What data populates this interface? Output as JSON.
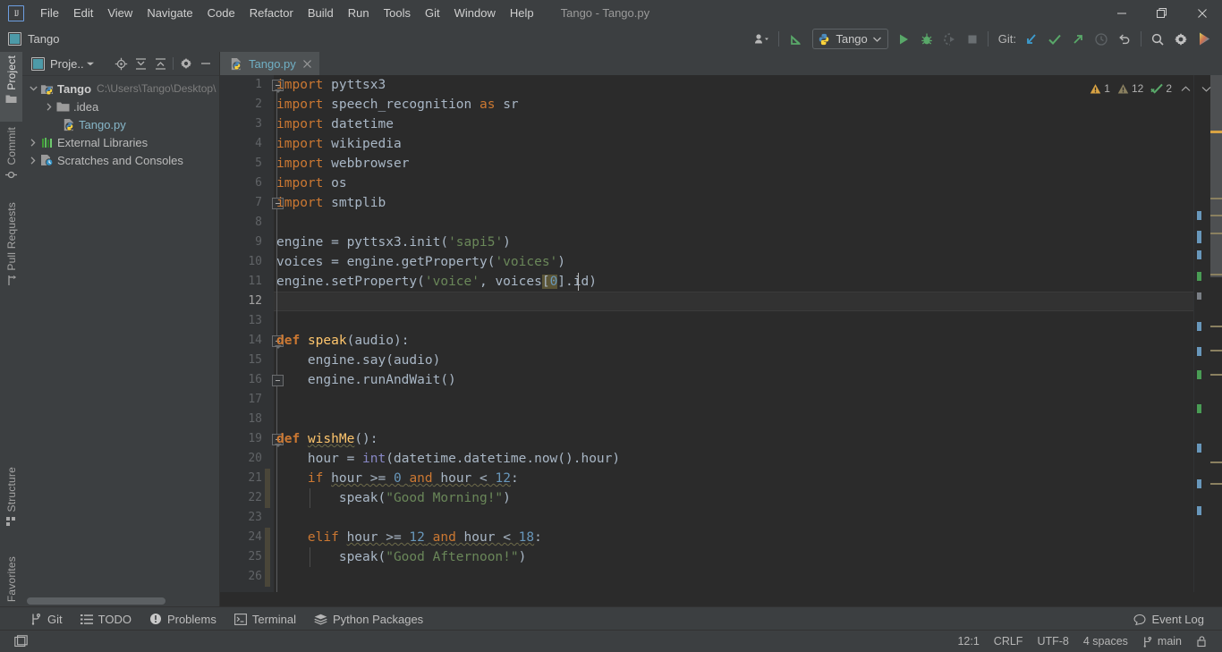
{
  "window": {
    "title": "Tango - Tango.py",
    "logo_text": "IJ",
    "controls": {
      "minimize": "minimize-icon",
      "maximize": "maximize-icon",
      "close": "close-icon"
    }
  },
  "menubar": {
    "items": [
      {
        "label": "File"
      },
      {
        "label": "Edit"
      },
      {
        "label": "View"
      },
      {
        "label": "Navigate"
      },
      {
        "label": "Code"
      },
      {
        "label": "Refactor"
      },
      {
        "label": "Build"
      },
      {
        "label": "Run"
      },
      {
        "label": "Tools"
      },
      {
        "label": "Git"
      },
      {
        "label": "Window"
      },
      {
        "label": "Help"
      }
    ]
  },
  "toolbar": {
    "project_name": "Tango",
    "run_config": "Tango",
    "git_label": "Git:",
    "icons": [
      "user-switch-icon",
      "update-project-icon",
      "python-icon",
      "chevron-down-icon",
      "run-icon",
      "debug-icon",
      "run-coverage-icon",
      "stop-icon",
      "git-update-icon",
      "git-commit-icon",
      "git-push-icon",
      "history-icon",
      "undo-icon",
      "search-everywhere-icon",
      "settings-icon",
      "ide-help-icon"
    ]
  },
  "left_strip": {
    "tabs": [
      {
        "label": "Project",
        "icon": "project-folder-icon",
        "active": true
      },
      {
        "label": "Commit",
        "icon": "commit-icon",
        "active": false
      },
      {
        "label": "Pull Requests",
        "icon": "pull-request-icon",
        "active": false
      },
      {
        "label": "Structure",
        "icon": "structure-icon",
        "active": false
      },
      {
        "label": "Favorites",
        "icon": "star-icon",
        "active": false
      }
    ]
  },
  "project_panel": {
    "title": "Proje..",
    "toolbar_icons": [
      "select-opened-file-icon",
      "expand-all-icon",
      "collapse-all-icon",
      "settings-icon",
      "hide-icon"
    ],
    "tree": [
      {
        "label": "Tango",
        "path": "C:\\Users\\Tango\\Desktop\\",
        "icon": "python-project-icon",
        "indent": 0,
        "arrow": "expanded",
        "bold": true
      },
      {
        "label": ".idea",
        "path": "",
        "icon": "folder-icon",
        "indent": 1,
        "arrow": "collapsed",
        "bold": false
      },
      {
        "label": "Tango.py",
        "path": "",
        "icon": "python-file-icon",
        "indent": 1,
        "arrow": "none",
        "bold": false,
        "link": true
      },
      {
        "label": "External Libraries",
        "path": "",
        "icon": "libraries-icon",
        "indent": 0,
        "arrow": "collapsed",
        "bold": false
      },
      {
        "label": "Scratches and Consoles",
        "path": "",
        "icon": "scratches-icon",
        "indent": 0,
        "arrow": "collapsed",
        "bold": false
      }
    ]
  },
  "editor": {
    "tab": {
      "label": "Tango.py",
      "icon": "python-file-icon",
      "close": "close-icon"
    },
    "inspections": {
      "warnings_count": "1",
      "weak_warnings_count": "12",
      "ok_count": "2",
      "up_icon": "chevron-up-icon",
      "down_icon": "chevron-down-icon"
    },
    "current_line": 12,
    "lines": [
      {
        "n": 1,
        "text": "import pyttsx3"
      },
      {
        "n": 2,
        "text": "import speech_recognition as sr"
      },
      {
        "n": 3,
        "text": "import datetime"
      },
      {
        "n": 4,
        "text": "import wikipedia"
      },
      {
        "n": 5,
        "text": "import webbrowser"
      },
      {
        "n": 6,
        "text": "import os"
      },
      {
        "n": 7,
        "text": "import smtplib"
      },
      {
        "n": 8,
        "text": ""
      },
      {
        "n": 9,
        "text": "engine = pyttsx3.init('sapi5')"
      },
      {
        "n": 10,
        "text": "voices = engine.getProperty('voices')"
      },
      {
        "n": 11,
        "text": "engine.setProperty('voice', voices[0].id)"
      },
      {
        "n": 12,
        "text": ""
      },
      {
        "n": 13,
        "text": ""
      },
      {
        "n": 14,
        "text": "def speak(audio):"
      },
      {
        "n": 15,
        "text": "    engine.say(audio)"
      },
      {
        "n": 16,
        "text": "    engine.runAndWait()"
      },
      {
        "n": 17,
        "text": ""
      },
      {
        "n": 18,
        "text": ""
      },
      {
        "n": 19,
        "text": "def wishMe():"
      },
      {
        "n": 20,
        "text": "    hour = int(datetime.datetime.now().hour)"
      },
      {
        "n": 21,
        "text": "    if hour >= 0 and hour < 12:"
      },
      {
        "n": 22,
        "text": "        speak(\"Good Morning!\")"
      },
      {
        "n": 23,
        "text": ""
      },
      {
        "n": 24,
        "text": "    elif hour >= 12 and hour < 18:"
      },
      {
        "n": 25,
        "text": "        speak(\"Good Afternoon!\")"
      },
      {
        "n": 26,
        "text": ""
      }
    ]
  },
  "toolwindow_bar": {
    "buttons": [
      {
        "label": "Git",
        "icon": "git-branch-icon"
      },
      {
        "label": "TODO",
        "icon": "todo-list-icon"
      },
      {
        "label": "Problems",
        "icon": "problems-icon"
      },
      {
        "label": "Terminal",
        "icon": "terminal-icon"
      },
      {
        "label": "Python Packages",
        "icon": "python-packages-icon"
      }
    ],
    "event_log": {
      "label": "Event Log",
      "icon": "event-log-icon"
    }
  },
  "statusbar": {
    "layout_icon": "layout-icon",
    "caret_position": "12:1",
    "line_separator": "CRLF",
    "encoding": "UTF-8",
    "indent": "4 spaces",
    "branch": "main",
    "branch_icon": "git-branch-icon",
    "lock_icon": "readonly-lock-icon"
  },
  "colors": {
    "bg_chrome": "#3c3f41",
    "bg_editor": "#2b2b2b",
    "bg_gutter": "#313335",
    "accent_link": "#70b0c5",
    "keyword": "#cc7832",
    "string": "#6a8759",
    "number": "#6897bb",
    "function": "#ffc66d",
    "plain": "#a9b7c6",
    "builtin": "#8888c6",
    "run_green": "#59a869",
    "warning_yellow": "#d9a343",
    "changebar": "#4a4639"
  }
}
